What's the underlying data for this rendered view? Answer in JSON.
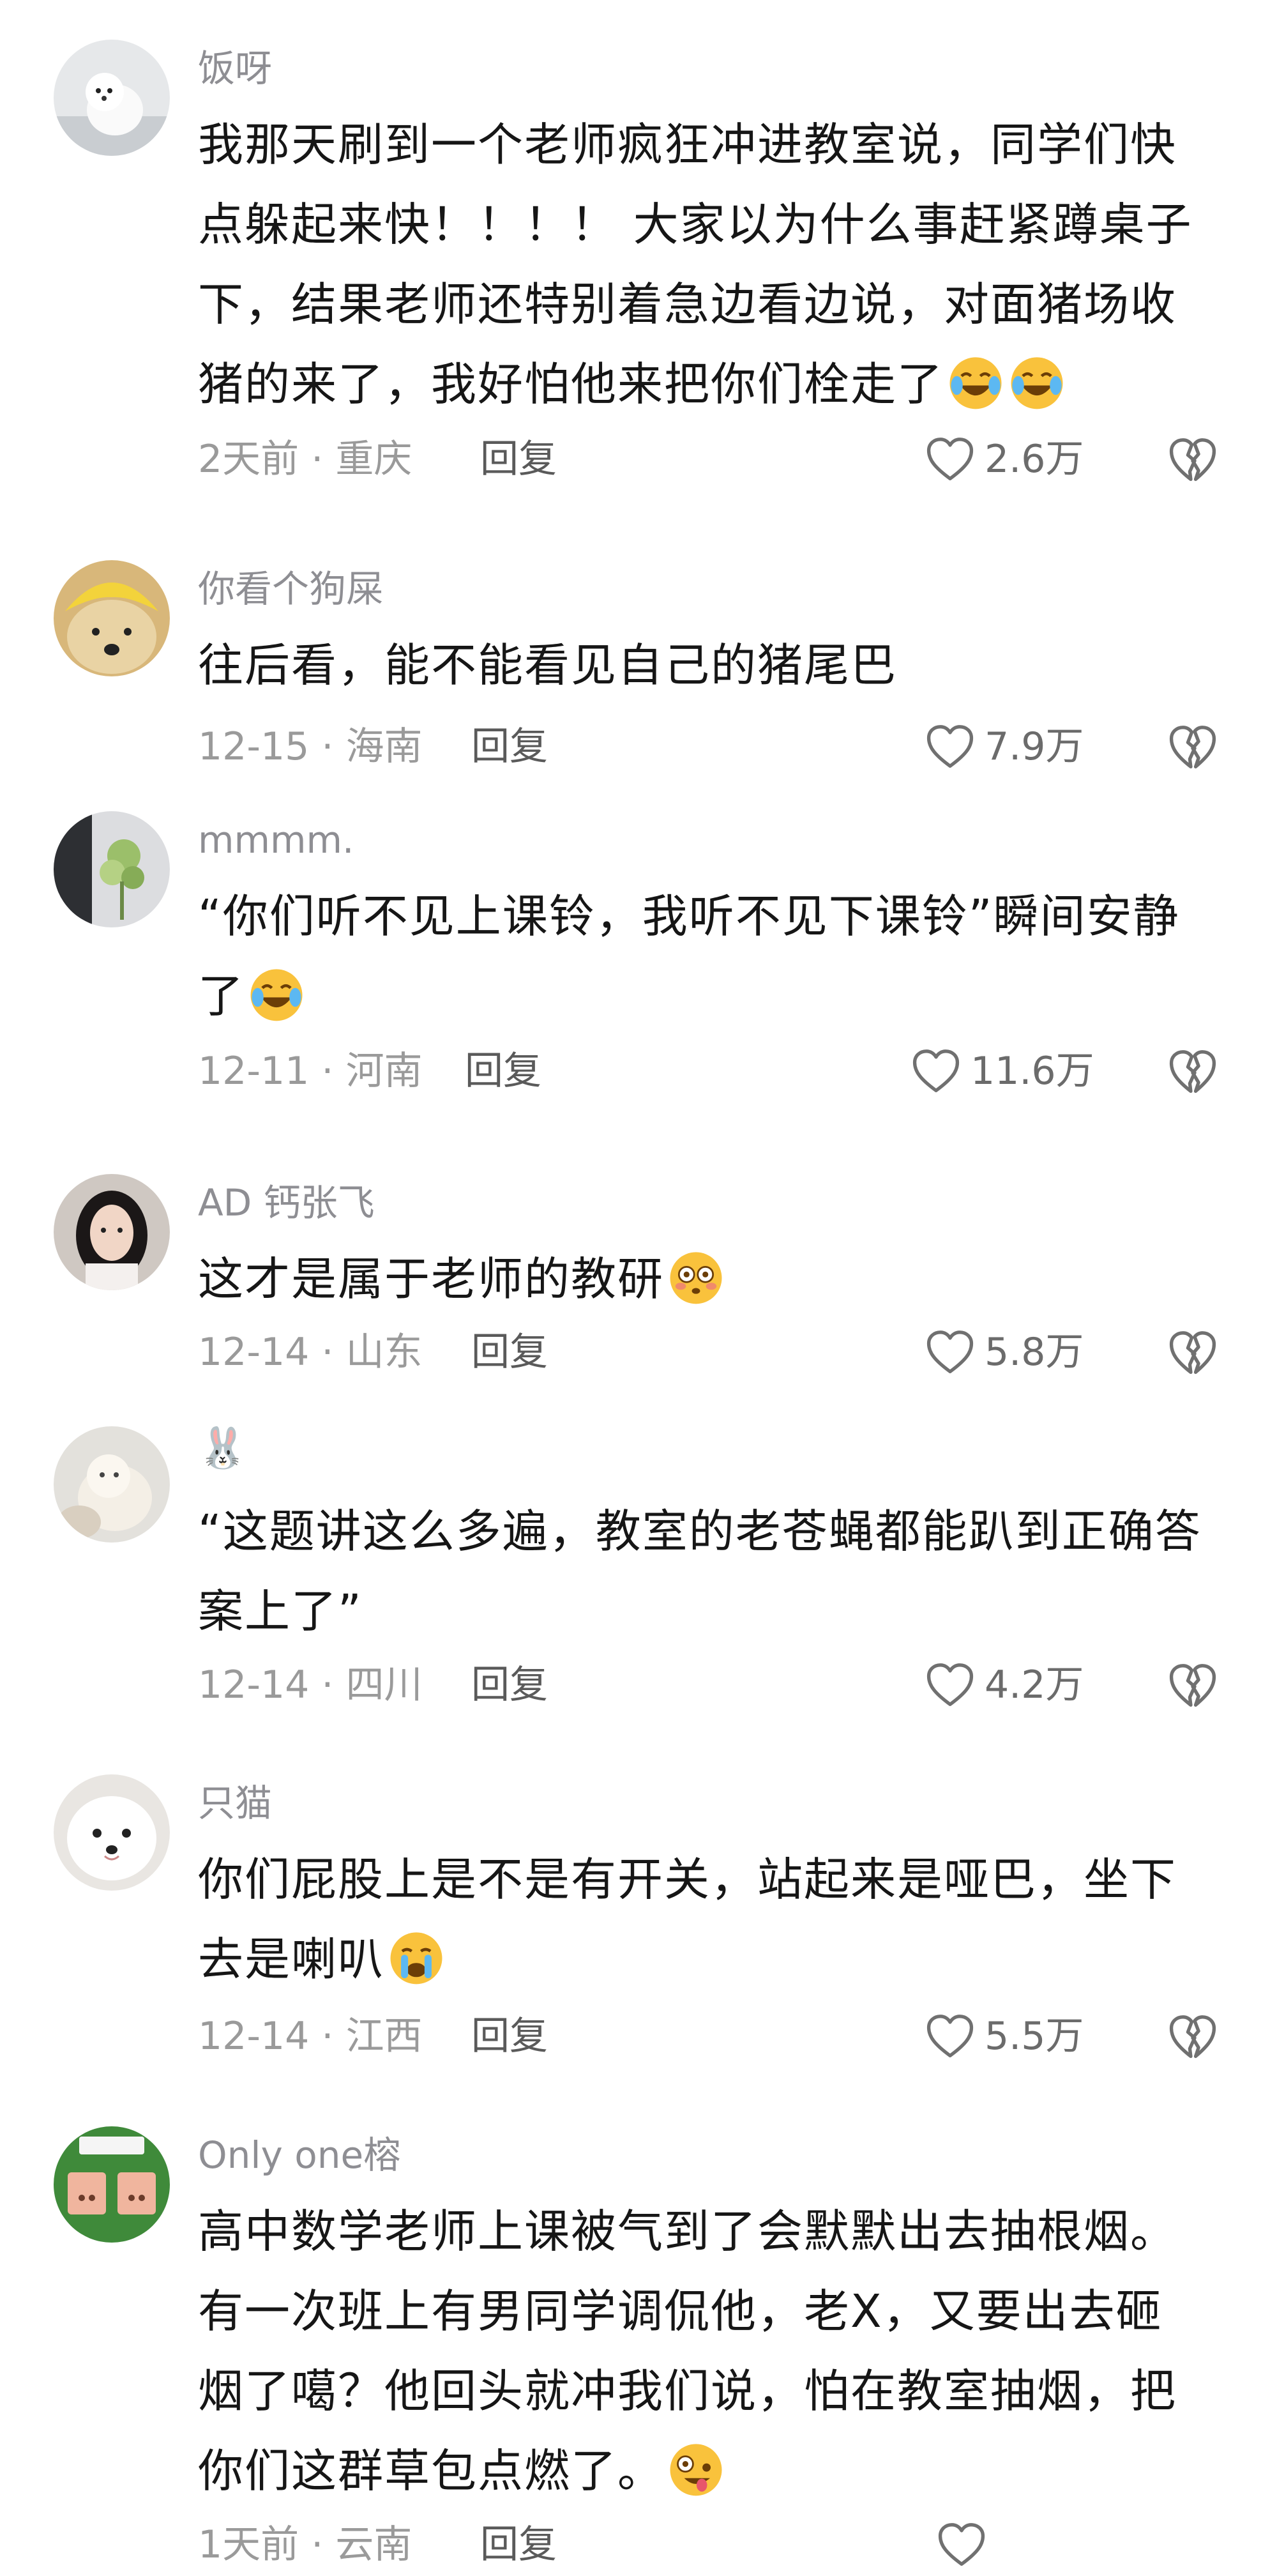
{
  "comments": [
    {
      "username": "饭呀",
      "lines": [
        "我那天刷到一个老师疯狂冲进教室说，同学们快",
        "点躲起来快！！！！ 大家以为什么事赶紧蹲桌子",
        "下，结果老师还特别着急边看边说，对面猪场收",
        "猪的来了，我好怕他来把你们栓走了"
      ],
      "emojis": [
        "crying-laughing-emoji",
        "crying-laughing-emoji"
      ],
      "time_location": "2天前 · 重庆",
      "reply_label": "回复",
      "likes": "2.6万"
    },
    {
      "username": "你看个狗屎",
      "lines": [
        "往后看，能不能看见自己的猪尾巴"
      ],
      "emojis": [],
      "time_location": "12-15 · 海南",
      "reply_label": "回复",
      "likes": "7.9万"
    },
    {
      "username": "mmmm.",
      "lines": [
        "“你们听不见上课铃，我听不见下课铃”瞬间安静",
        "了"
      ],
      "emojis": [
        "crying-laughing-emoji"
      ],
      "time_location": "12-11 · 河南",
      "reply_label": "回复",
      "likes": "11.6万"
    },
    {
      "username": "AD 钙张飞",
      "lines": [
        "这才是属于老师的教研"
      ],
      "emojis": [
        "flushed-emoji"
      ],
      "time_location": "12-14 · 山东",
      "reply_label": "回复",
      "likes": "5.8万"
    },
    {
      "username": "🐰",
      "lines": [
        "“这题讲这么多遍，教室的老苍蝇都能趴到正确答",
        "案上了”"
      ],
      "emojis": [],
      "time_location": "12-14 · 四川",
      "reply_label": "回复",
      "likes": "4.2万"
    },
    {
      "username": "只猫",
      "lines": [
        "你们屁股上是不是有开关，站起来是哑巴，坐下",
        "去是喇叭"
      ],
      "emojis": [
        "crying-emoji"
      ],
      "time_location": "12-14 · 江西",
      "reply_label": "回复",
      "likes": "5.5万"
    },
    {
      "username": "Only one榕",
      "lines": [
        "高中数学老师上课被气到了会默默出去抽根烟。",
        "有一次班上有男同学调侃他，老X，又要出去砸",
        "烟了噶？他回头就冲我们说，怕在教室抽烟，把",
        "你们这群草包点燃了。"
      ],
      "emojis": [
        "zany-emoji"
      ],
      "time_location": "1天前 · 云南",
      "reply_label": "回复",
      "likes": ""
    }
  ],
  "colors": {
    "username": "#8e8e93",
    "text": "#161616",
    "meta": "#9a9a9a",
    "icon_stroke": "#707070"
  },
  "icons": {
    "like": "heart-outline-icon",
    "dislike": "broken-heart-icon"
  }
}
